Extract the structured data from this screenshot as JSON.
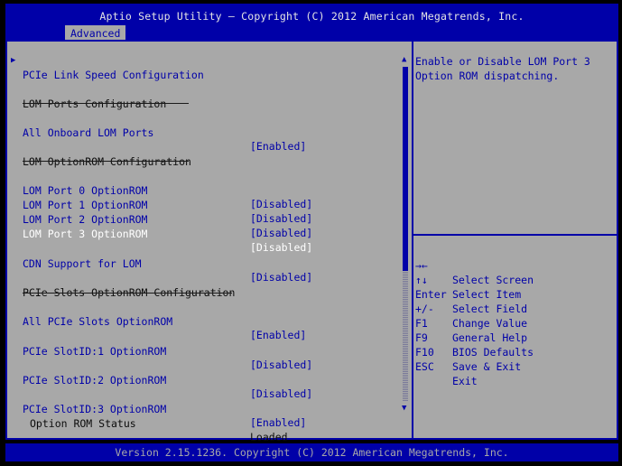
{
  "header": {
    "title": "Aptio Setup Utility – Copyright (C) 2012 American Megatrends, Inc.",
    "tab_active": "Advanced"
  },
  "menu": {
    "submenu_marker": "▶",
    "items": [
      {
        "label": "PCIe Link Speed Configuration",
        "value": ""
      },
      {
        "label": "LOM Ports Configuration",
        "value": ""
      },
      {
        "label": "All Onboard LOM Ports",
        "value": "[Enabled]"
      },
      {
        "label": "LOM OptionROM Configuration",
        "value": ""
      },
      {
        "label": "LOM Port 0 OptionROM",
        "value": "[Disabled]"
      },
      {
        "label": "LOM Port 1 OptionROM",
        "value": "[Disabled]"
      },
      {
        "label": "LOM Port 2 OptionROM",
        "value": "[Disabled]"
      },
      {
        "label": "LOM Port 3 OptionROM",
        "value": "[Disabled]"
      },
      {
        "label": "CDN Support for LOM",
        "value": "[Disabled]"
      },
      {
        "label": "PCIe Slots OptionROM Configuration",
        "value": ""
      },
      {
        "label": "All PCIe Slots OptionROM",
        "value": "[Enabled]"
      },
      {
        "label": "PCIe SlotID:1 OptionROM",
        "value": "[Disabled]"
      },
      {
        "label": "PCIe SlotID:2 OptionROM",
        "value": "[Disabled]"
      },
      {
        "label": "PCIe SlotID:3 OptionROM",
        "value": "[Enabled]"
      },
      {
        "label": "Option ROM Status",
        "value": "Loaded"
      }
    ]
  },
  "scrollbar": {
    "up_arrow": "▲",
    "down_arrow": "▼"
  },
  "help": {
    "text": "Enable or Disable LOM Port 3 Option ROM dispatching."
  },
  "keys": [
    {
      "key": "→←",
      "desc": "Select Screen"
    },
    {
      "key": "↑↓",
      "desc": "Select Item"
    },
    {
      "key": "Enter",
      "desc": "Select Field"
    },
    {
      "key": "+/-",
      "desc": "Change Value"
    },
    {
      "key": "F1",
      "desc": "General Help"
    },
    {
      "key": "F9",
      "desc": "BIOS Defaults"
    },
    {
      "key": "F10",
      "desc": "Save & Exit"
    },
    {
      "key": "ESC",
      "desc": "Exit"
    }
  ],
  "footer": {
    "version": "Version 2.15.1236. Copyright (C) 2012 American Megatrends, Inc."
  },
  "colors": {
    "bios_blue": "#0000a8",
    "panel_gray": "#a8a8a8",
    "highlight_white": "#ffffff"
  }
}
